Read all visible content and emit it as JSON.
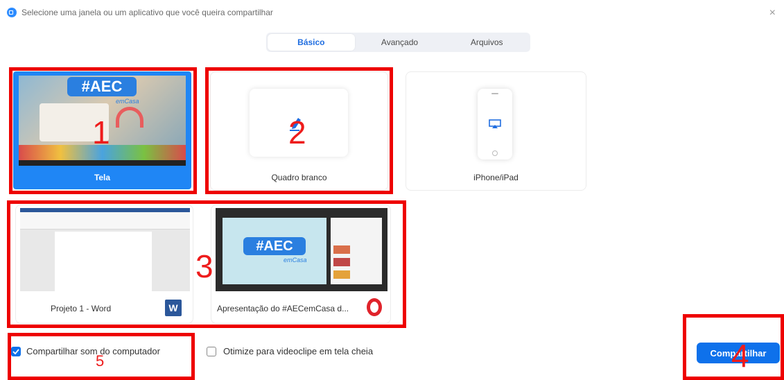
{
  "header": {
    "title": "Selecione uma janela ou um aplicativo que você queira compartilhar",
    "close": "×"
  },
  "tabs": [
    {
      "label": "Básico"
    },
    {
      "label": "Avançado"
    },
    {
      "label": "Arquivos"
    }
  ],
  "cards": {
    "tela": {
      "label": "Tela",
      "thumb_text": "#AEC",
      "thumb_sub": "emCasa"
    },
    "quadro": {
      "label": "Quadro branco"
    },
    "iphone": {
      "label": "iPhone/iPad"
    },
    "word": {
      "label": "Projeto 1 - Word",
      "app_letter": "W"
    },
    "opera": {
      "label": "Apresentação do #AECemCasa d...",
      "thumb_text": "#AEC",
      "thumb_sub": "emCasa"
    }
  },
  "options": {
    "sound": {
      "label": "Compartilhar som do computador",
      "checked": true
    },
    "video": {
      "label": "Otimize para videoclipe em tela cheia",
      "checked": false
    }
  },
  "share_button": "Compartilhar",
  "annotations": {
    "n1": "1",
    "n2": "2",
    "n3": "3",
    "n4": "4",
    "n5": "5"
  },
  "colors": {
    "accent": "#0e71eb",
    "annotation": "#ee0000"
  }
}
